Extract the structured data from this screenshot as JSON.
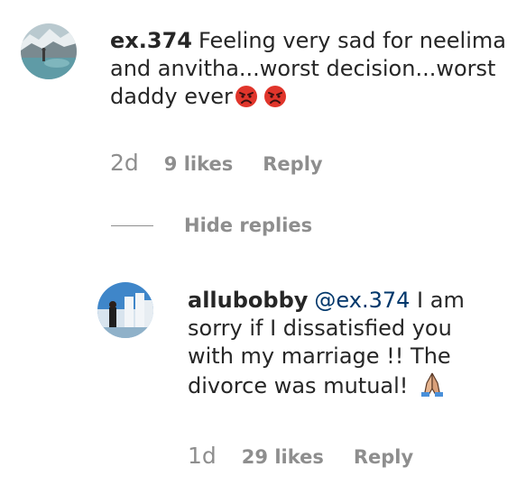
{
  "comment": {
    "username": "ex.374",
    "text": "Feeling very sad for neelima and anvitha...worst decision...worst daddy ever",
    "emojis": [
      "angry-face-icon",
      "angry-face-icon"
    ],
    "time": "2d",
    "likes": "9 likes",
    "reply_label": "Reply"
  },
  "thread": {
    "hide_replies_label": "Hide replies"
  },
  "reply": {
    "username": "allubobby",
    "mention": "@ex.374",
    "text_line1": "I am",
    "text_line2": "sorry if I dissatisfied you",
    "text_line3": "with my marriage !! The",
    "text_line4": "divorce was mutual!",
    "emoji": "folded-hands-icon",
    "time": "1d",
    "likes": "29 likes",
    "reply_label": "Reply"
  },
  "colors": {
    "text": "#262626",
    "secondary": "#8e8e8e",
    "mention": "#00376b",
    "angry_emoji": "#e0352b"
  }
}
